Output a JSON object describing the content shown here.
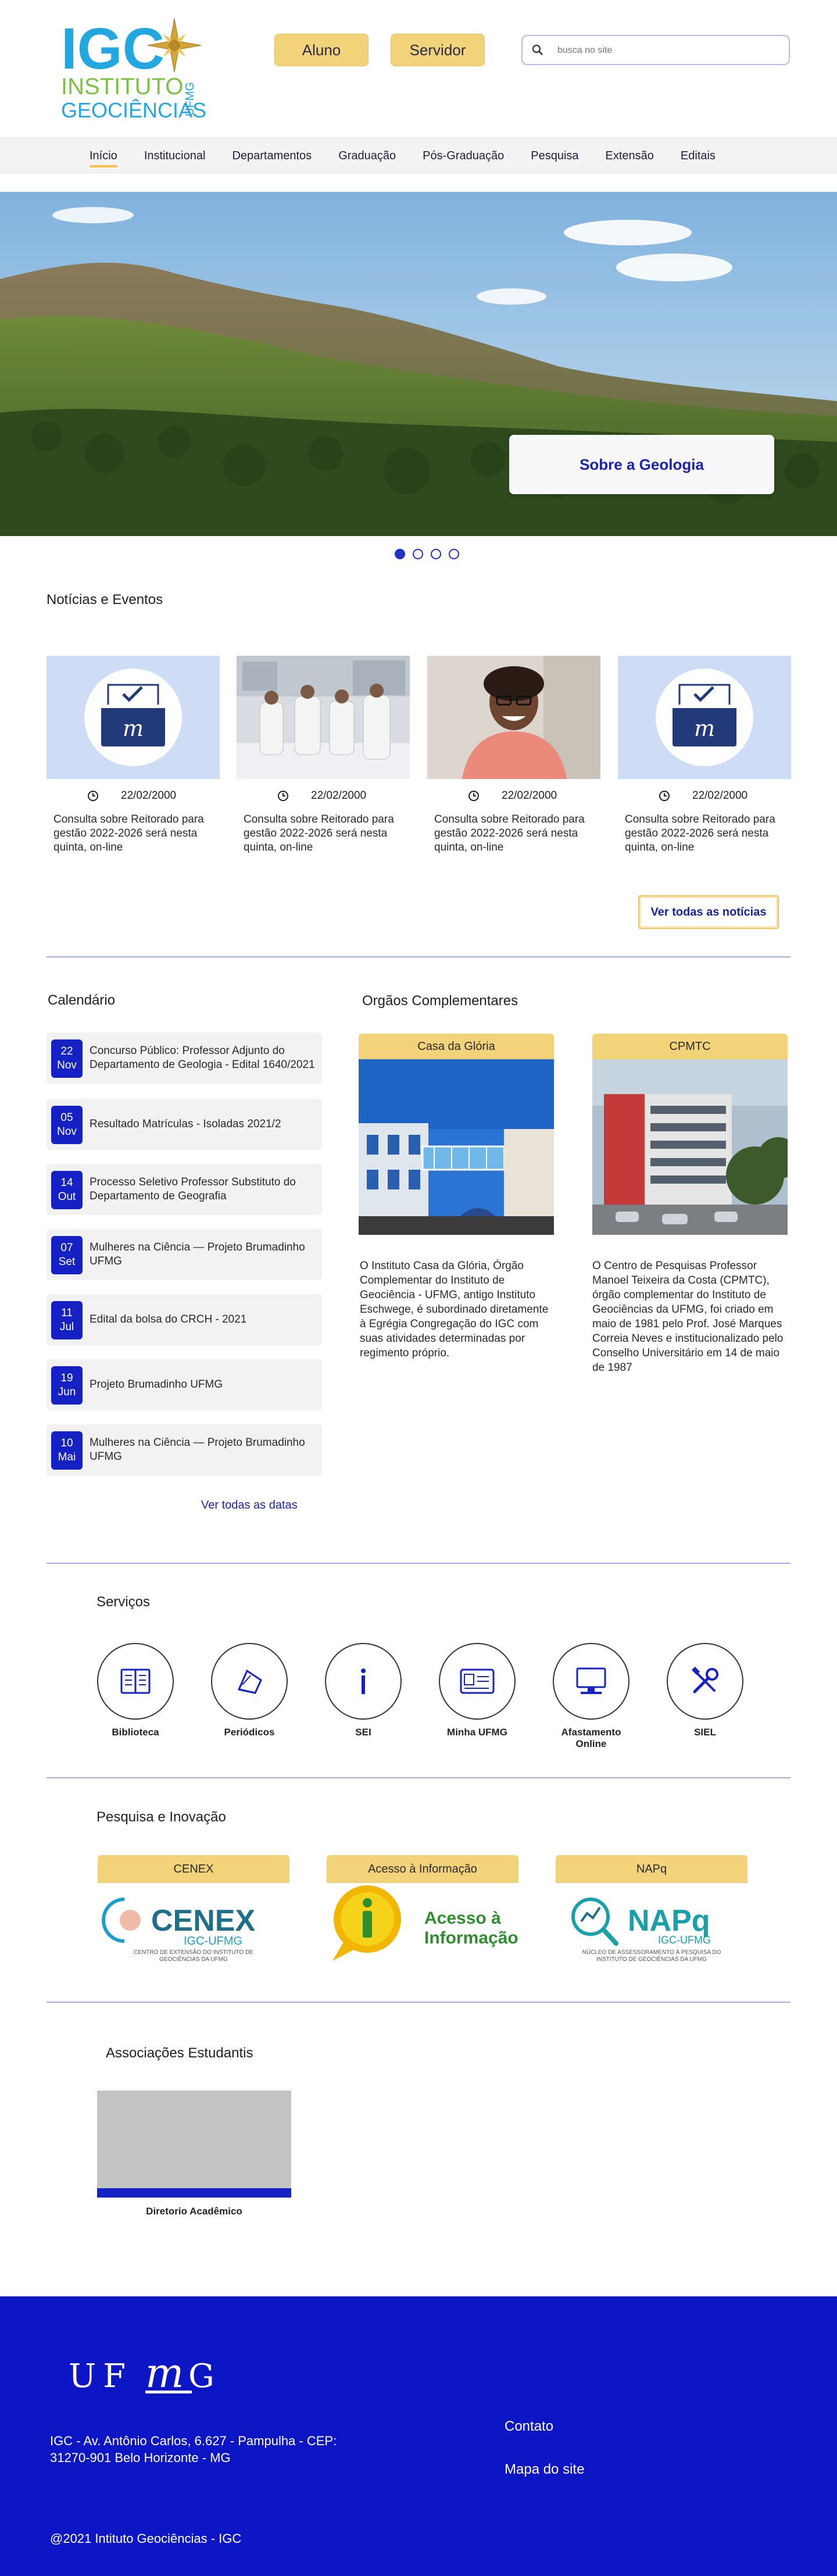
{
  "header": {
    "logo_text_big": "IGC",
    "logo_text_line1": "INSTITUTO",
    "logo_text_line2": "GEOCIÊNCIAS",
    "logo_text_side": "UFMG",
    "aluno_label": "Aluno",
    "servidor_label": "Servidor",
    "search_placeholder": "busca no site"
  },
  "nav": {
    "items": [
      "Início",
      "Institucional",
      "Departamentos",
      "Graduação",
      "Pós-Graduação",
      "Pesquisa",
      "Extensão",
      "Editais"
    ],
    "active_index": 0
  },
  "hero": {
    "cta_label": "Sobre a Geologia",
    "slide_count": 4,
    "active_slide": 0
  },
  "news": {
    "title": "Notícias e Eventos",
    "items": [
      {
        "date": "22/02/2000",
        "text": "Consulta sobre Reitorado para gestão 2022-2026 será nesta quinta, on-line",
        "image": "ballot-box-icon"
      },
      {
        "date": "22/02/2000",
        "text": "Consulta sobre Reitorado para gestão 2022-2026 será nesta quinta, on-line",
        "image": "lab-photo"
      },
      {
        "date": "22/02/2000",
        "text": "Consulta sobre Reitorado para gestão 2022-2026 será nesta quinta, on-line",
        "image": "student-photo"
      },
      {
        "date": "22/02/2000",
        "text": "Consulta sobre Reitorado para gestão 2022-2026 será nesta quinta, on-line",
        "image": "ballot-box-icon"
      }
    ],
    "see_all_label": "Ver todas as notícias"
  },
  "calendar": {
    "title": "Calendário",
    "items": [
      {
        "day": "22",
        "month": "Nov",
        "text": "Concurso Público: Professor Adjunto do Departamento de Geologia - Edital 1640/2021"
      },
      {
        "day": "05",
        "month": "Nov",
        "text": "Resultado Matrículas - Isoladas 2021/2"
      },
      {
        "day": "14",
        "month": "Out",
        "text": "Processo Seletivo Professor Substituto do Departamento de Geografia"
      },
      {
        "day": "07",
        "month": "Set",
        "text": "Mulheres na Ciência — Projeto Brumadinho UFMG"
      },
      {
        "day": "11",
        "month": "Jul",
        "text": "Edital da bolsa do CRCH - 2021"
      },
      {
        "day": "19",
        "month": "Jun",
        "text": "Projeto Brumadinho UFMG"
      },
      {
        "day": "10",
        "month": "Mai",
        "text": "Mulheres na Ciência — Projeto Brumadinho UFMG"
      }
    ],
    "see_all_label": "Ver todas as datas"
  },
  "organs": {
    "title": "Orgãos Complementares",
    "items": [
      {
        "tag": "Casa da Glória",
        "text": "O Instituto Casa da Glória, Órgão Complementar do Instituto de Geociência - UFMG, antigo Instituto Eschwege, é subordinado diretamente à Egrégia Congregação do IGC com suas atividades determinadas por regimento próprio."
      },
      {
        "tag": "CPMTC",
        "text": "O Centro de Pesquisas Professor Manoel Teixeira da Costa (CPMTC), órgão complementar do Instituto de Geociências da UFMG, foi criado em maio de 1981 pelo Prof. José Marques Correia Neves e institucionalizado pelo Conselho Universitário em 14 de maio de 1987"
      }
    ]
  },
  "services": {
    "title": "Serviços",
    "items": [
      {
        "label": "Biblioteca",
        "icon": "book-icon"
      },
      {
        "label": "Periódicos",
        "icon": "journal-icon"
      },
      {
        "label": "SEI",
        "icon": "sei-icon"
      },
      {
        "label": "Minha UFMG",
        "icon": "id-card-icon"
      },
      {
        "label": "Afastamento Online",
        "icon": "computer-icon"
      },
      {
        "label": "SIEL",
        "icon": "tools-icon"
      }
    ]
  },
  "research": {
    "title": "Pesquisa e Inovação",
    "items": [
      {
        "tag": "CENEX",
        "logo_main": "CENEX",
        "logo_sub": "IGC-UFMG",
        "logo_caption": "CENTRO DE EXTENSÃO DO INSTITUTO DE GEOCIÊNCIAS DA UFMG"
      },
      {
        "tag": "Acesso à Informação",
        "logo_main": "Acesso à",
        "logo_sub": "Informação",
        "logo_caption": ""
      },
      {
        "tag": "NAPq",
        "logo_main": "NAPq",
        "logo_sub": "IGC-UFMG",
        "logo_caption": "NÚCLEO DE ASSESSORAMENTO À PESQUISA DO INSTITUTO DE GEOCIÊNCIAS DA UFMG"
      }
    ]
  },
  "associations": {
    "title": "Associações Estudantis",
    "items": [
      {
        "label": "Diretorio Acadêmico"
      }
    ]
  },
  "footer": {
    "ufmg_logo": "UFMG",
    "address": "IGC - Av. Antônio Carlos, 6.627 - Pampulha - CEP: 31270-901 Belo Horizonte - MG",
    "contact_label": "Contato",
    "sitemap_label": "Mapa do site",
    "copyright": "@2021 Intituto Geociências - IGC"
  },
  "colors": {
    "primary_blue": "#1621c4",
    "accent_yellow": "#f2d37a",
    "logo_cyan": "#22a7df",
    "logo_green": "#7cc242"
  }
}
